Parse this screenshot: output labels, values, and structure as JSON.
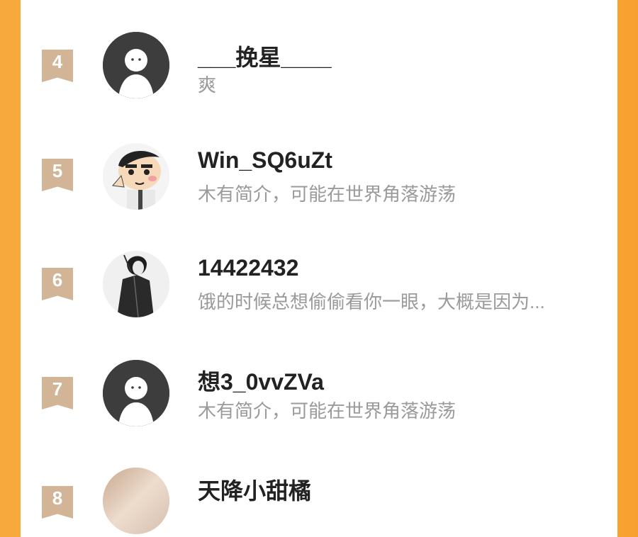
{
  "rows": [
    {
      "rank": "4",
      "name": "___挽星____",
      "bio": "爽",
      "avatar": "default-avatar"
    },
    {
      "rank": "5",
      "name": "Win_SQ6uZt",
      "bio": "木有简介，可能在世界角落游荡",
      "avatar": "cartoon-boy-avatar"
    },
    {
      "rank": "6",
      "name": "14422432",
      "bio": "饿的时候总想偷偷看你一眼，大概是因为...",
      "avatar": "anime-swordsman-avatar"
    },
    {
      "rank": "7",
      "name": "想3_0vvZVa",
      "bio": "木有简介，可能在世界角落游荡",
      "avatar": "default-avatar"
    },
    {
      "rank": "8",
      "name": "天降小甜橘",
      "bio": "",
      "avatar": "photo-avatar"
    }
  ],
  "colors": {
    "side_orange": "#f8a93e",
    "rank_badge": "#d1b596",
    "name_text": "#222222",
    "bio_text": "#9a9a9a"
  }
}
